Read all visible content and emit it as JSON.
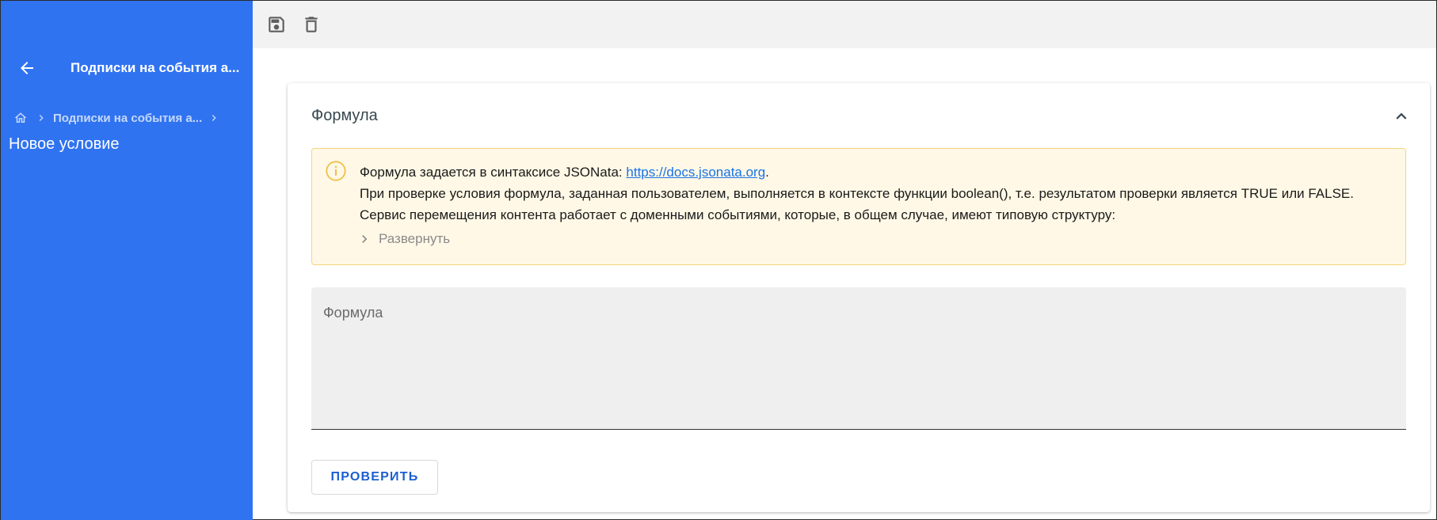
{
  "sidebar": {
    "title": "Подписки на события а...",
    "breadcrumb": {
      "parent": "Подписки на события а..."
    },
    "page_title": "Новое условие",
    "color": "#3073f0"
  },
  "toolbar": {
    "icons": [
      "save-icon",
      "delete-icon"
    ]
  },
  "card": {
    "title": "Формула",
    "alert": {
      "line1_prefix": "Формула задается в синтаксисе JSONata: ",
      "link_text": "https://docs.jsonata.org",
      "line1_suffix": ".",
      "line2": "При проверке условия формула, заданная пользователем, выполняется в контексте функции boolean(), т.е. результатом проверки является TRUE или FALSE.",
      "line3": "Сервис перемещения контента работает с доменными событиями, которые, в общем случае, имеют типовую структуру:",
      "expand_label": "Развернуть"
    },
    "formula_field": {
      "label": "Формула",
      "value": ""
    },
    "check_button": "ПРОВЕРИТЬ"
  },
  "colors": {
    "accent": "#3073f0",
    "alert_bg": "#fff8e6",
    "alert_border": "#f5d57a",
    "link": "#1a73e8",
    "button_text": "#1a5fd1"
  }
}
